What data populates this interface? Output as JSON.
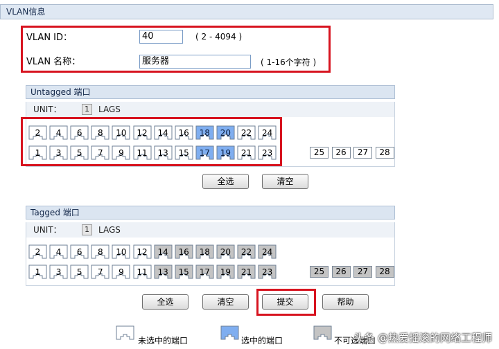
{
  "vlan_info": {
    "header": "VLAN信息",
    "id_label": "VLAN ID：",
    "id_value": "40",
    "id_hint": "( 2 - 4094 )",
    "name_label": "VLAN 名称：",
    "name_value": "服务器",
    "name_hint": "( 1-16个字符 )"
  },
  "untagged": {
    "header": "Untagged 端口",
    "unit_label": "UNIT：",
    "unit_value": "1",
    "lags_label": "LAGS",
    "top_row": [
      {
        "num": "2",
        "state": "unselected"
      },
      {
        "num": "4",
        "state": "unselected"
      },
      {
        "num": "6",
        "state": "unselected"
      },
      {
        "num": "8",
        "state": "unselected"
      },
      {
        "num": "10",
        "state": "unselected"
      },
      {
        "num": "12",
        "state": "unselected"
      },
      {
        "num": "14",
        "state": "unselected"
      },
      {
        "num": "16",
        "state": "unselected"
      },
      {
        "num": "18",
        "state": "selected"
      },
      {
        "num": "20",
        "state": "selected"
      },
      {
        "num": "22",
        "state": "unselected"
      },
      {
        "num": "24",
        "state": "unselected"
      }
    ],
    "bottom_row": [
      {
        "num": "1",
        "state": "unselected"
      },
      {
        "num": "3",
        "state": "unselected"
      },
      {
        "num": "5",
        "state": "unselected"
      },
      {
        "num": "7",
        "state": "unselected"
      },
      {
        "num": "9",
        "state": "unselected"
      },
      {
        "num": "11",
        "state": "unselected"
      },
      {
        "num": "13",
        "state": "unselected"
      },
      {
        "num": "15",
        "state": "unselected"
      },
      {
        "num": "17",
        "state": "selected"
      },
      {
        "num": "19",
        "state": "selected"
      },
      {
        "num": "21",
        "state": "unselected"
      },
      {
        "num": "23",
        "state": "unselected"
      }
    ],
    "lags": [
      {
        "num": "25",
        "state": "unselected"
      },
      {
        "num": "26",
        "state": "unselected"
      },
      {
        "num": "27",
        "state": "unselected"
      },
      {
        "num": "28",
        "state": "unselected"
      }
    ],
    "select_all_label": "全选",
    "clear_label": "清空"
  },
  "tagged": {
    "header": "Tagged 端口",
    "unit_label": "UNIT：",
    "unit_value": "1",
    "lags_label": "LAGS",
    "top_row": [
      {
        "num": "2",
        "state": "unselected"
      },
      {
        "num": "4",
        "state": "unselected"
      },
      {
        "num": "6",
        "state": "unselected"
      },
      {
        "num": "8",
        "state": "unselected"
      },
      {
        "num": "10",
        "state": "unselected"
      },
      {
        "num": "12",
        "state": "unselected"
      },
      {
        "num": "14",
        "state": "unavailable"
      },
      {
        "num": "16",
        "state": "unavailable"
      },
      {
        "num": "18",
        "state": "unavailable"
      },
      {
        "num": "20",
        "state": "unavailable"
      },
      {
        "num": "22",
        "state": "unavailable"
      },
      {
        "num": "24",
        "state": "unavailable"
      }
    ],
    "bottom_row": [
      {
        "num": "1",
        "state": "unselected"
      },
      {
        "num": "3",
        "state": "unselected"
      },
      {
        "num": "5",
        "state": "unselected"
      },
      {
        "num": "7",
        "state": "unselected"
      },
      {
        "num": "9",
        "state": "unselected"
      },
      {
        "num": "11",
        "state": "unselected"
      },
      {
        "num": "13",
        "state": "unavailable"
      },
      {
        "num": "15",
        "state": "unavailable"
      },
      {
        "num": "17",
        "state": "unavailable"
      },
      {
        "num": "19",
        "state": "unavailable"
      },
      {
        "num": "21",
        "state": "unavailable"
      },
      {
        "num": "23",
        "state": "unavailable"
      }
    ],
    "lags": [
      {
        "num": "25",
        "state": "unavailable"
      },
      {
        "num": "26",
        "state": "unavailable"
      },
      {
        "num": "27",
        "state": "unavailable"
      },
      {
        "num": "28",
        "state": "unavailable"
      }
    ]
  },
  "actions": {
    "select_all_label": "全选",
    "clear_label": "清空",
    "submit_label": "提交",
    "help_label": "帮助"
  },
  "legend": {
    "unselected_label": "未选中的端口",
    "selected_label": "选中的端口",
    "unavailable_label": "不可选端口"
  },
  "watermark": "头条 @热爱摇滚的网络工程师",
  "colors": {
    "selected_fill": "#7faef0",
    "unavailable_fill": "#c4c4c4",
    "unselected_fill": "#ffffff",
    "highlight_red": "#d7131f"
  }
}
